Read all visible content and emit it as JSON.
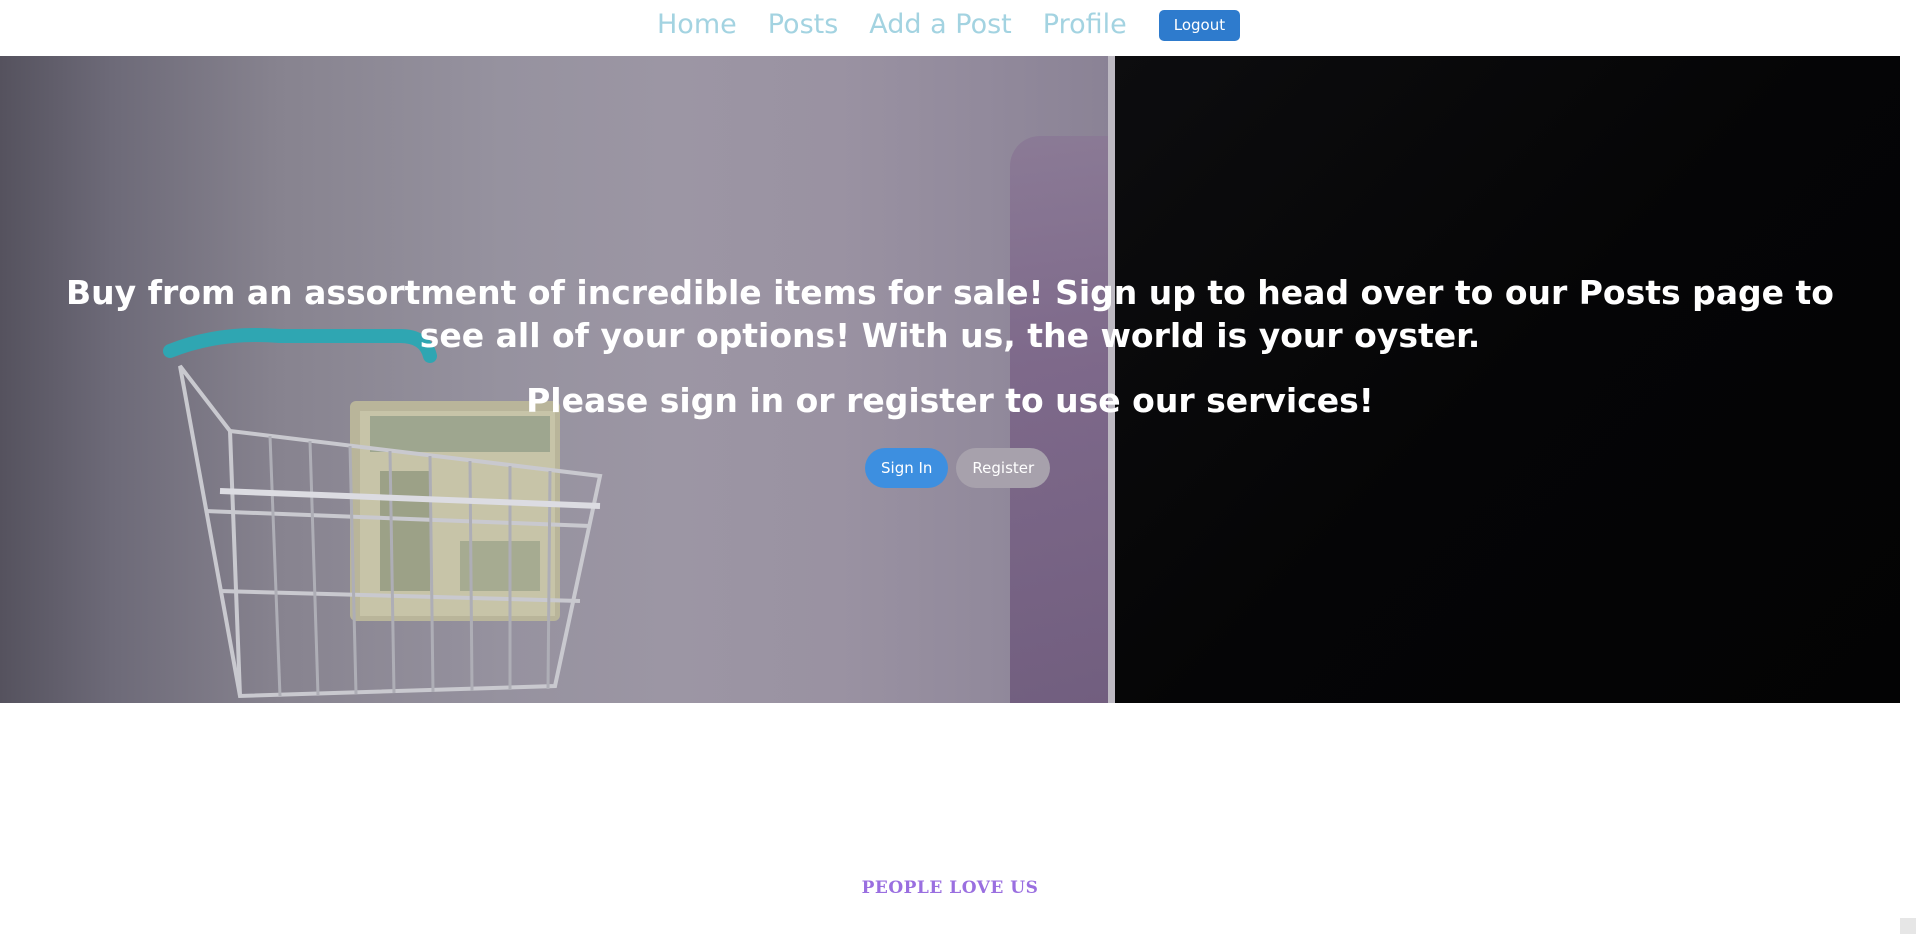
{
  "nav": {
    "items": [
      {
        "label": "Home"
      },
      {
        "label": "Posts"
      },
      {
        "label": "Add a Post"
      },
      {
        "label": "Profile"
      }
    ],
    "logout_label": "Logout",
    "link_color": "#a3d3e1",
    "logout_color": "#2e7bcd"
  },
  "hero": {
    "headline": "Buy from an assortment of incredible items for sale! Sign up to head over to our Posts page to see all of your options! With us, the world is your oyster.",
    "subheadline": "Please sign in or register to use our services!",
    "signin_label": "Sign In",
    "register_label": "Register",
    "image_description_icon": "shopping-cart-with-money-image",
    "signin_color": "#3d8fe0",
    "register_color": "#a7a1ac"
  },
  "section": {
    "heading": "PEOPLE LOVE US",
    "heading_color": "#9a6fe0"
  }
}
